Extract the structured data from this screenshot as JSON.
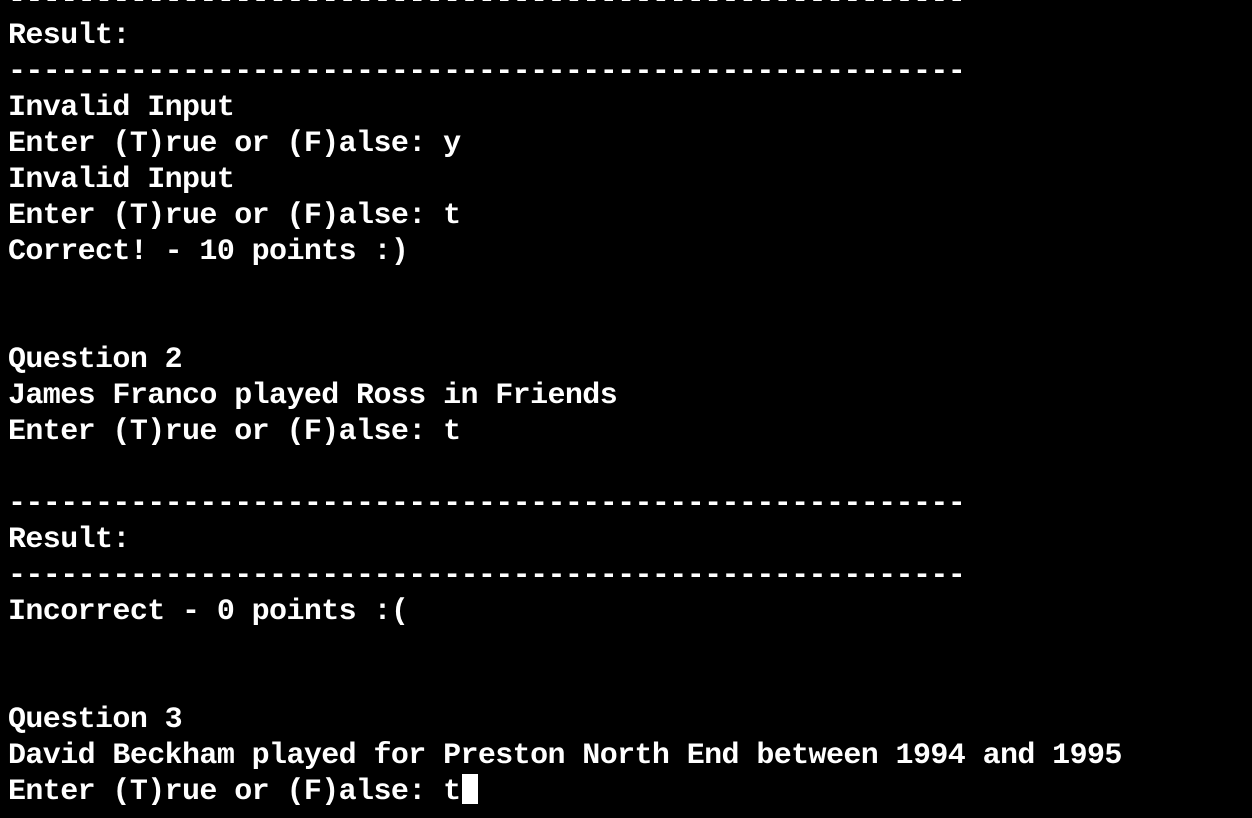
{
  "terminal": {
    "lines": [
      "-------------------------------------------------------",
      "Result:",
      "-------------------------------------------------------",
      "Invalid Input",
      "Enter (T)rue or (F)alse: y",
      "Invalid Input",
      "Enter (T)rue or (F)alse: t",
      "Correct! - 10 points :)",
      "",
      "",
      "Question 2",
      "James Franco played Ross in Friends",
      "Enter (T)rue or (F)alse: t",
      "",
      "-------------------------------------------------------",
      "Result:",
      "-------------------------------------------------------",
      "Incorrect - 0 points :(",
      "",
      "",
      "Question 3",
      "David Beckham played for Preston North End between 1994 and 1995",
      "Enter (T)rue or (F)alse: t"
    ]
  },
  "colors": {
    "background": "#000000",
    "text": "#ffffff"
  }
}
